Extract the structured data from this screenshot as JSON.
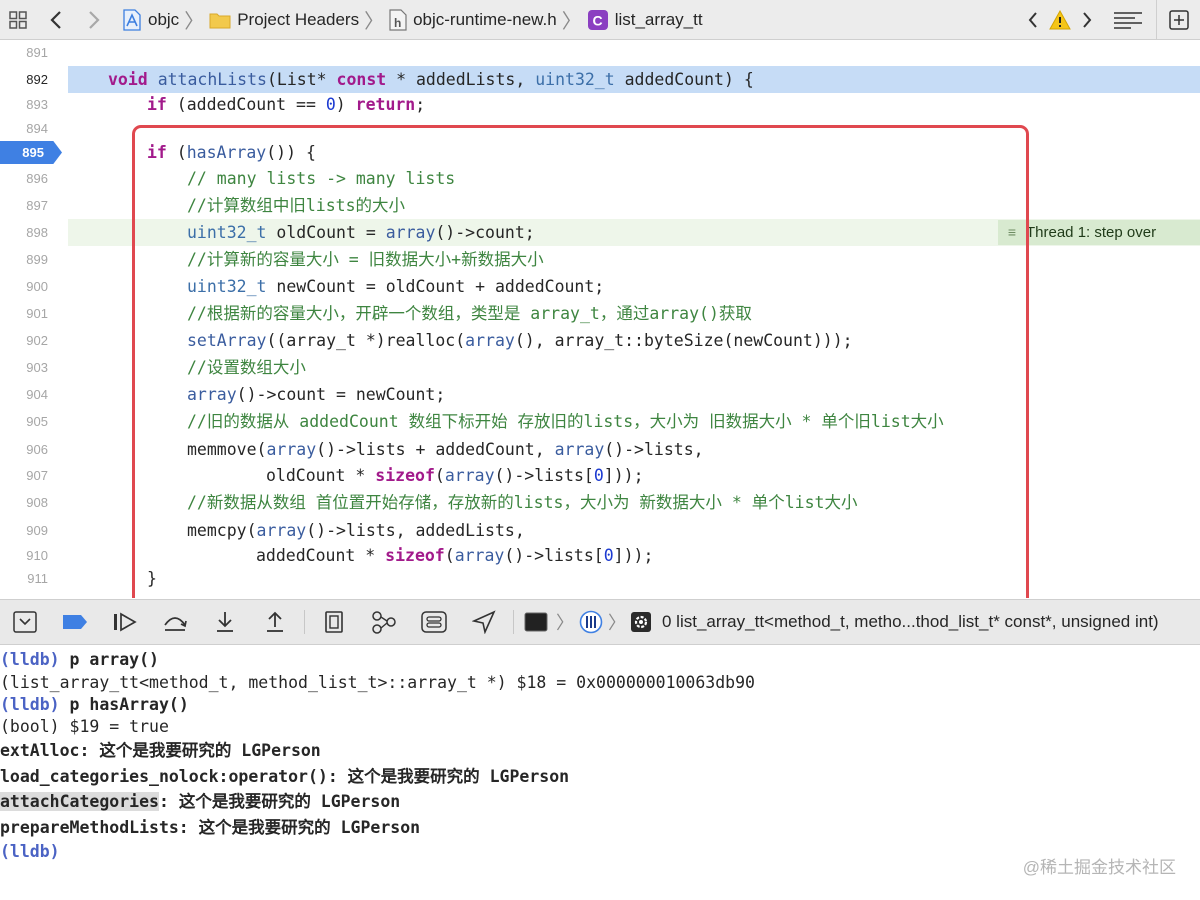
{
  "jumpbar": {
    "crumbs": [
      "objc",
      "Project Headers",
      "objc-runtime-new.h",
      "list_array_tt"
    ],
    "file_type_letter": "h",
    "class_letter": "C"
  },
  "editor": {
    "line_numbers": [
      "891",
      "892",
      "893",
      "894",
      "895",
      "896",
      "897",
      "898",
      "899",
      "900",
      "901",
      "902",
      "903",
      "904",
      "905",
      "906",
      "907",
      "908",
      "909",
      "910",
      "911"
    ],
    "breakpoint_line": "895",
    "thread_label": "Thread 1: step over",
    "l892": {
      "kw_void": "void",
      "fn": "attachLists",
      "p1": "(List* ",
      "kw_const": "const",
      "p2": " * addedLists, ",
      "ty": "uint32_t",
      "p3": " addedCount) {"
    },
    "l893": {
      "kw_if": "if",
      "p1": " (addedCount == ",
      "num": "0",
      "p2": ") ",
      "kw_return": "return",
      "p3": ";"
    },
    "l895": {
      "kw_if": "if",
      "p1": " (",
      "fn": "hasArray",
      "p2": "()) {"
    },
    "l896": "// many lists -> many lists",
    "l897": "//计算数组中旧lists的大小",
    "l898": {
      "ty": "uint32_t",
      "p1": " oldCount = ",
      "fn": "array",
      "p2": "()->count;"
    },
    "l899": "//计算新的容量大小 = 旧数据大小+新数据大小",
    "l900": {
      "ty": "uint32_t",
      "p1": " newCount = oldCount + addedCount;"
    },
    "l901": "//根据新的容量大小，开辟一个数组，类型是 array_t，通过array()获取",
    "l902": {
      "fn": "setArray",
      "p1": "((array_t *)realloc(",
      "fn2": "array",
      "p2": "(), array_t::byteSize(newCount)));"
    },
    "l903": "//设置数组大小",
    "l904": {
      "fn": "array",
      "p1": "()->count = newCount;"
    },
    "l905": "//旧的数据从 addedCount 数组下标开始 存放旧的lists，大小为 旧数据大小 * 单个旧list大小",
    "l906": {
      "p0": "memmove(",
      "fn": "array",
      "p1": "()->lists + addedCount, ",
      "fn2": "array",
      "p2": "()->lists,"
    },
    "l907": {
      "p0": "oldCount * ",
      "kw": "sizeof",
      "p1": "(",
      "fn": "array",
      "p2": "()->lists[",
      "num": "0",
      "p3": "]));"
    },
    "l908": "//新数据从数组 首位置开始存储，存放新的lists，大小为 新数据大小 * 单个list大小",
    "l909": {
      "p0": "memcpy(",
      "fn": "array",
      "p1": "()->lists, addedLists,"
    },
    "l910": {
      "p0": "addedCount * ",
      "kw": "sizeof",
      "p1": "(",
      "fn": "array",
      "p2": "()->lists[",
      "num": "0",
      "p3": "]));"
    },
    "l911": "}"
  },
  "debugbar": {
    "frame_label": "0 list_array_tt<method_t, metho...thod_list_t* const*, unsigned int)"
  },
  "console": {
    "prompt": "(lldb)",
    "c1_cmd": " p array()",
    "c2": "(list_array_tt<method_t, method_list_t>::array_t *) $18 = 0x000000010063db90",
    "c3_cmd": " p hasArray()",
    "c4": "(bool) $19 = true",
    "c5": "extAlloc: 这个是我要研究的 LGPerson",
    "c6": "load_categories_nolock:operator(): 这个是我要研究的 LGPerson",
    "c7_sel": "attachCategories",
    "c7_rest": ": 这个是我要研究的 LGPerson",
    "c8": "prepareMethodLists: 这个是我要研究的 LGPerson",
    "watermark": "@稀土掘金技术社区"
  },
  "colors": {
    "keyword": "#a21a8b",
    "function": "#3a5c9e",
    "comment": "#3e8540",
    "number": "#1c3ad1",
    "breakpoint": "#3f80e3",
    "annotation_box": "#e0484f",
    "thread_highlight": "#d8ead0"
  },
  "icons": [
    "grid-icon",
    "back-arrow-icon",
    "forward-arrow-icon",
    "xcode-project-icon",
    "folder-icon",
    "header-file-icon",
    "class-icon",
    "warning-icon",
    "menu-lines-icon",
    "add-editor-icon",
    "console-toggle-icon",
    "breakpoint-toggle-icon",
    "continue-icon",
    "step-over-icon",
    "step-into-icon",
    "step-out-icon",
    "view-debugger-icon",
    "memory-graph-icon",
    "environment-icon",
    "location-icon",
    "thread-icon",
    "queue-icon",
    "frame-gear-icon"
  ]
}
